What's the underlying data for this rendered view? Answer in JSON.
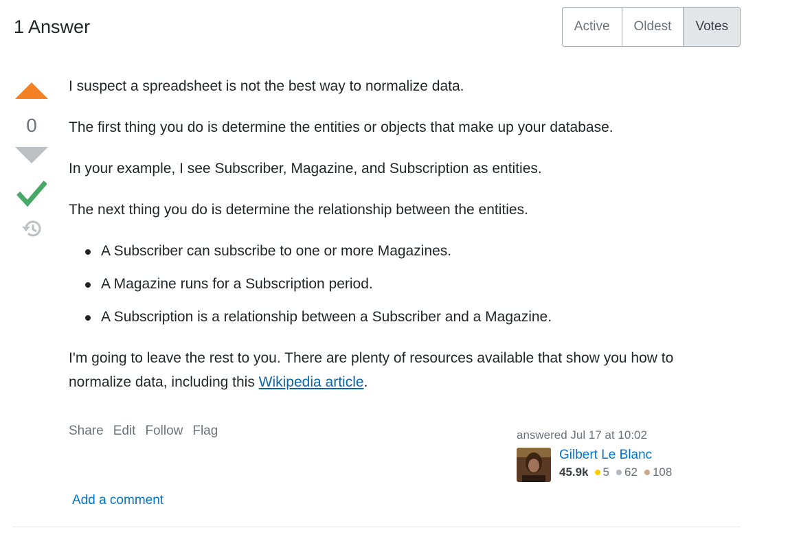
{
  "header": {
    "answer_count": "1 Answer",
    "sort_options": [
      "Active",
      "Oldest",
      "Votes"
    ],
    "selected_sort": "Votes"
  },
  "votes": {
    "score": "0",
    "accepted": true
  },
  "post": {
    "paragraphs": [
      "I suspect a spreadsheet is not the best way to normalize data.",
      "The first thing you do is determine the entities or objects that make up your database.",
      "In your example, I see Subscriber, Magazine, and Subscription as entities.",
      "The next thing you do is determine the relationship between the entities."
    ],
    "list_items": [
      "A Subscriber can subscribe to one or more Magazines.",
      "A Magazine runs for a Subscription period.",
      "A Subscription is a relationship between a Subscriber and a Magazine."
    ],
    "closing_text": "I'm going to leave the rest to you. There are plenty of resources available that show you how to normalize data, including this ",
    "link_text": "Wikipedia article",
    "closing_end": "."
  },
  "menu": {
    "share": "Share",
    "edit": "Edit",
    "follow": "Follow",
    "flag": "Flag"
  },
  "signature": {
    "action": "answered Jul 17 at 10:02",
    "user_name": "Gilbert Le Blanc",
    "reputation": "45.9k",
    "gold": "5",
    "silver": "62",
    "bronze": "108"
  },
  "comments": {
    "add_label": "Add a comment"
  },
  "colors": {
    "upvote": "#f48225",
    "downvote": "#bbc0c4",
    "accepted": "#48a868",
    "link": "#0074cc",
    "gold": "#ffcc01",
    "silver": "#b4b8bc",
    "bronze": "#d1a684"
  },
  "icons": [
    "upvote-arrow-icon",
    "downvote-arrow-icon",
    "accepted-check-icon",
    "history-icon"
  ]
}
